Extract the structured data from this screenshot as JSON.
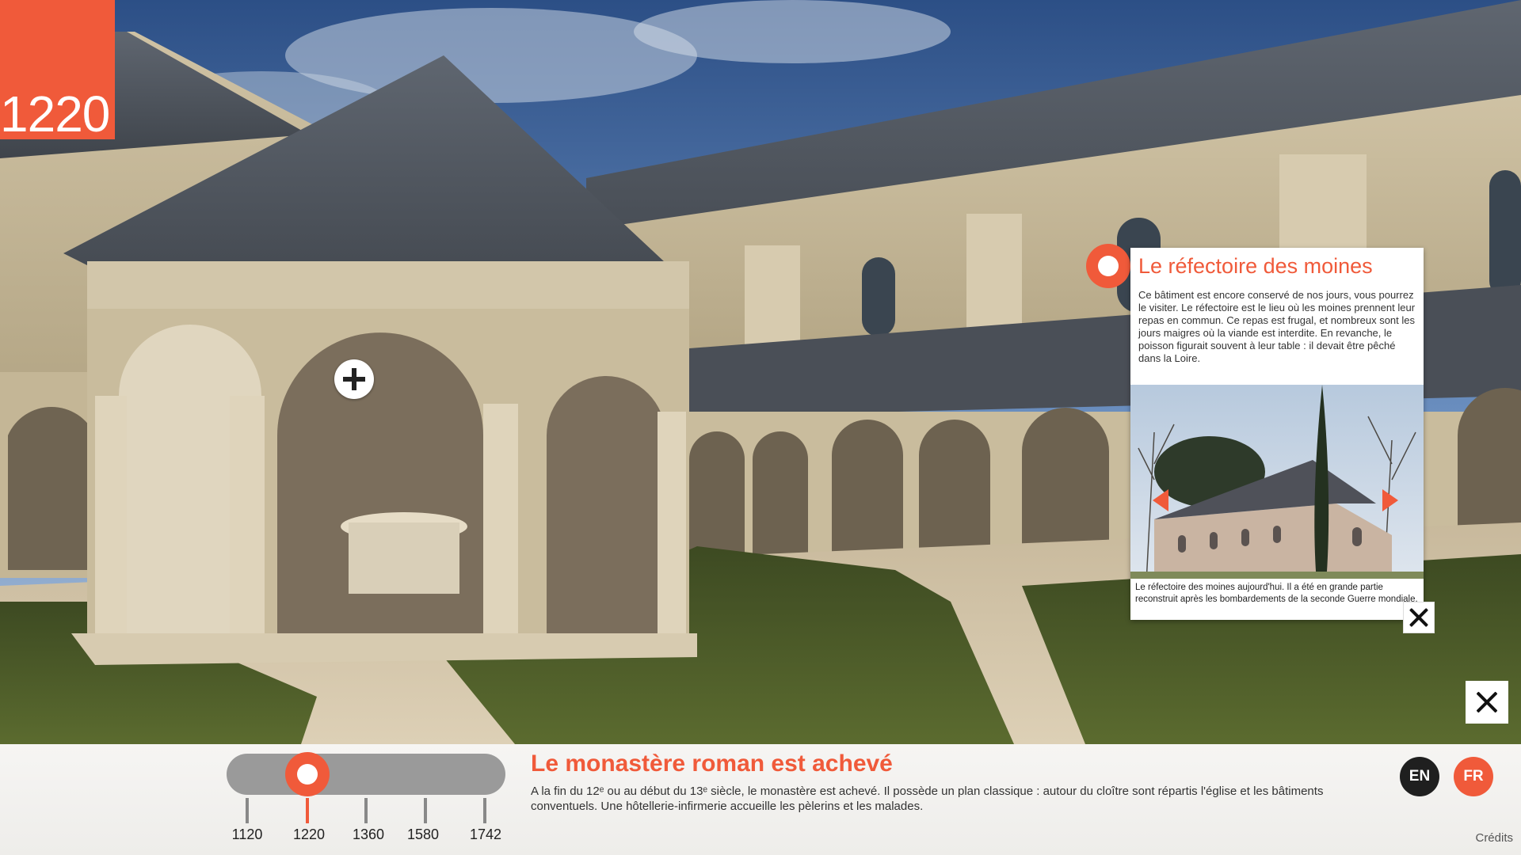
{
  "year": "1220",
  "hotspot": {
    "icon": "plus-icon"
  },
  "info_panel": {
    "title": "Le réfectoire des moines",
    "text": "Ce bâtiment est encore conservé de nos jours, vous pourrez le visiter. Le réfectoire est le lieu où les moines prennent leur repas en commun. Ce repas est frugal, et nombreux sont les jours maigres où la viande est interdite. En revanche, le poisson figurait souvent à leur table : il devait être pêché dans la Loire.",
    "caption": "Le réfectoire des moines aujourd'hui. Il a été en grande partie reconstruit après les bombardements de la seconde Guerre mondiale."
  },
  "timeline": {
    "ticks": [
      "1120",
      "1220",
      "1360",
      "1580",
      "1742"
    ],
    "selected": "1220"
  },
  "era": {
    "title": "Le monastère roman est achevé",
    "text": "A la fin du 12ᵉ ou au début du 13ᵉ siècle, le monastère est achevé. Il possède un plan classique : autour du cloître sont répartis l'église et les bâtiments conventuels. Une hôtellerie-infirmerie accueille les pèlerins et les malades."
  },
  "languages": [
    "EN",
    "FR"
  ],
  "active_language": "FR",
  "credits": "Crédits",
  "colors": {
    "accent": "#f05a3a",
    "dark": "#1f1f1f"
  }
}
